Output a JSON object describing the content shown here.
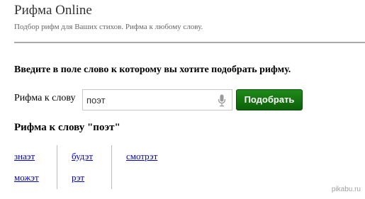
{
  "header": {
    "title": "Рифма Online",
    "subtitle": "Подбор рифм для Ваших стихов. Рифма к любому слову."
  },
  "form": {
    "instruction": "Введите в поле слово к которому вы хотите подобрать рифму.",
    "label": "Рифма к слову",
    "input_value": "поэт",
    "submit_label": "Подобрать",
    "mic_icon": "microphone-icon"
  },
  "results": {
    "heading": "Рифма к слову \"поэт\"",
    "columns": [
      [
        "знаэт",
        "можэт"
      ],
      [
        "будэт",
        "рэт"
      ],
      [
        "смотрэт"
      ]
    ]
  },
  "watermark": "pikabu.ru",
  "colors": {
    "button": "#0f6e0c",
    "link": "#0000cc",
    "divider": "#a9a9a9"
  }
}
